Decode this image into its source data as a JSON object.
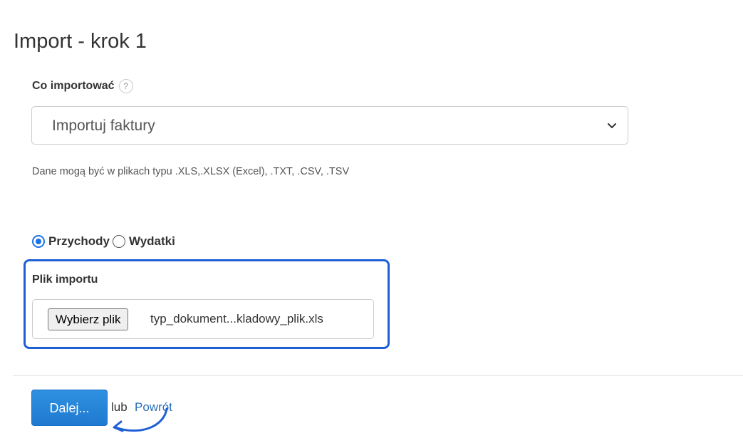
{
  "page": {
    "title": "Import - krok 1"
  },
  "import_type": {
    "label": "Co importować",
    "help_icon": "question-mark-icon",
    "help_glyph": "?",
    "selected": "Importuj faktury",
    "hint": "Dane mogą być w plikach typu .XLS,.XLSX (Excel), .TXT, .CSV, .TSV"
  },
  "direction": {
    "options": [
      {
        "label": "Przychody",
        "checked": true
      },
      {
        "label": "Wydatki",
        "checked": false
      }
    ]
  },
  "file": {
    "label": "Plik importu",
    "button_label": "Wybierz plik",
    "file_name": "typ_dokument...kladowy_plik.xls"
  },
  "actions": {
    "next_label": "Dalej...",
    "or_text": "lub",
    "back_label": "Powrót"
  },
  "colors": {
    "accent": "#1f5fd6",
    "primary_button": "#1f7ad0",
    "link": "#2a6ebb"
  }
}
